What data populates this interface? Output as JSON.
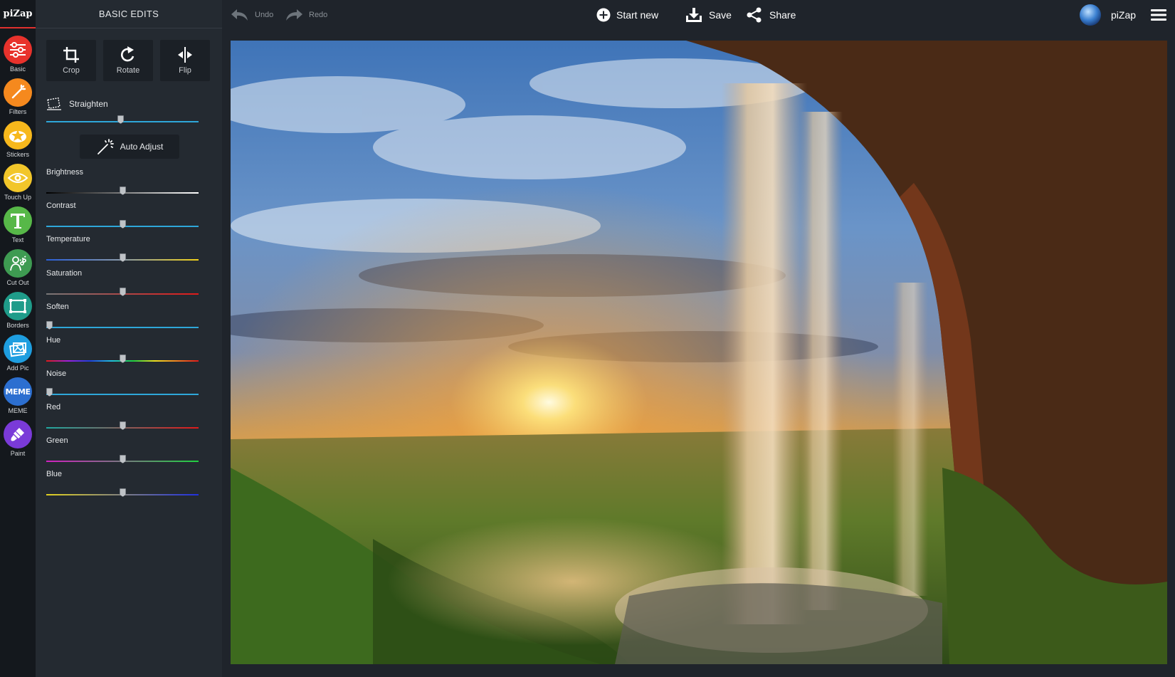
{
  "app": {
    "logo": "piZap"
  },
  "rail": {
    "tools": [
      {
        "label": "Basic",
        "icon": "sliders-icon",
        "color": "#e8322c"
      },
      {
        "label": "Filters",
        "icon": "magic-wand-icon",
        "color": "#f5891e"
      },
      {
        "label": "Stickers",
        "icon": "star-icon",
        "color": "#f7b81c"
      },
      {
        "label": "Touch Up",
        "icon": "eye-icon",
        "color": "#f2c62a"
      },
      {
        "label": "Text",
        "icon": "letter-t-icon",
        "color": "#57b848"
      },
      {
        "label": "Cut Out",
        "icon": "cutout-figure-icon",
        "color": "#3e9b52"
      },
      {
        "label": "Borders",
        "icon": "frame-icon",
        "color": "#1f9c8a"
      },
      {
        "label": "Add Pic",
        "icon": "add-picture-icon",
        "color": "#1e9ee0"
      },
      {
        "label": "MEME",
        "icon": "meme-text-icon",
        "color": "#2c6fd0",
        "badge": "MEME"
      },
      {
        "label": "Paint",
        "icon": "paint-brush-icon",
        "color": "#7a3ad8"
      }
    ]
  },
  "panel": {
    "title": "BASIC EDITS",
    "crop_label": "Crop",
    "rotate_label": "Rotate",
    "flip_label": "Flip",
    "straighten_label": "Straighten",
    "straighten_value": 0.49,
    "auto_adjust_label": "Auto Adjust",
    "sliders": [
      {
        "label": "Brightness",
        "value": 0.5
      },
      {
        "label": "Contrast",
        "value": 0.5
      },
      {
        "label": "Temperature",
        "value": 0.5
      },
      {
        "label": "Saturation",
        "value": 0.5
      },
      {
        "label": "Soften",
        "value": 0.0
      },
      {
        "label": "Hue",
        "value": 0.5
      },
      {
        "label": "Noise",
        "value": 0.0
      },
      {
        "label": "Red",
        "value": 0.5
      },
      {
        "label": "Green",
        "value": 0.5
      },
      {
        "label": "Blue",
        "value": 0.5
      }
    ]
  },
  "topbar": {
    "undo_label": "Undo",
    "redo_label": "Redo",
    "start_new_label": "Start new",
    "save_label": "Save",
    "share_label": "Share",
    "user_name": "piZap"
  }
}
